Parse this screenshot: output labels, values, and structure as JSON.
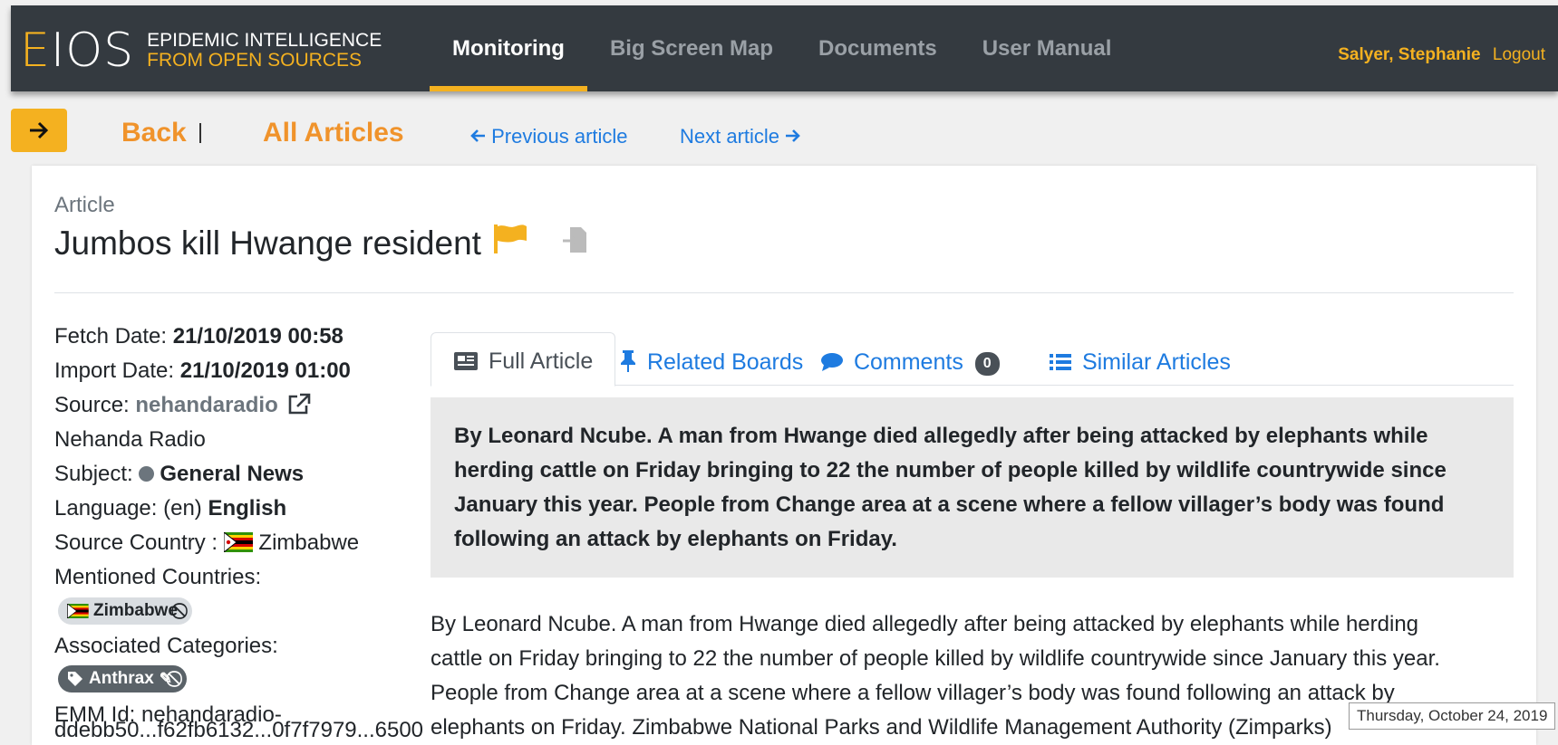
{
  "header": {
    "logo_mark": "EIOS",
    "logo_line1": "EPIDEMIC INTELLIGENCE",
    "logo_line2": "FROM OPEN SOURCES",
    "nav": [
      "Monitoring",
      "Big Screen Map",
      "Documents",
      "User Manual"
    ],
    "active_nav": "Monitoring",
    "user_name": "Salyer, Stephanie",
    "logout": "Logout"
  },
  "subnav": {
    "back": "Back",
    "all_articles": "All Articles",
    "previous": "Previous article",
    "next": "Next article"
  },
  "article": {
    "kicker": "Article",
    "title": "Jumbos kill Hwange resident",
    "fetch_label": "Fetch Date: ",
    "fetch_value": "21/10/2019 00:58",
    "import_label": "Import Date: ",
    "import_value": "21/10/2019 01:00",
    "source_label": "Source: ",
    "source_value": "nehandaradio",
    "source_name": "Nehanda Radio",
    "subject_label": "Subject: ",
    "subject_value": "General News",
    "language_label": "Language: (en) ",
    "language_value": "English",
    "source_country_label": "Source Country : ",
    "source_country_value": "Zimbabwe",
    "mentioned_label": "Mentioned Countries:",
    "mentioned_value": "Zimbabwe",
    "categories_label": "Associated Categories:",
    "category_value": "Anthrax",
    "emm_label": "EMM Id: nehandaradio-",
    "emm_cut": "ddebb50...f62fb6132...0f7f7979...6500"
  },
  "tabs": {
    "full_article": "Full Article",
    "related_boards": "Related Boards",
    "comments": "Comments",
    "comments_count": "0",
    "similar_articles": "Similar Articles"
  },
  "content": {
    "summary": "By Leonard Ncube. A man from Hwange died allegedly after being attacked by elephants while herding cattle on Friday bringing to 22 the number of people killed by wildlife countrywide since January this year. People from Change area at a scene where a fellow villager’s body was found following an attack by elephants on Friday.",
    "body_line1": "By Leonard Ncube. A man from Hwange died allegedly after being attacked by elephants while herding",
    "body_line2": "cattle on Friday bringing to 22 the number of people killed by wildlife countrywide since January this year.",
    "body_line3": "People from Change area at a scene where a fellow villager’s body was found following an attack by",
    "body_line4": "elephants on Friday. Zimbabwe National Parks and Wildlife Management Authority (Zimparks)"
  },
  "tooltip": "Thursday, October 24, 2019",
  "colors": {
    "header_bg": "#343a40",
    "accent": "#f4b120",
    "link": "#1e7be0",
    "back_orange": "#f0932b"
  },
  "icons": [
    "arrow-right-icon",
    "arrow-left-icon",
    "flag-icon",
    "export-icon",
    "external-link-icon",
    "newspaper-icon",
    "pin-icon",
    "comment-icon",
    "list-icon",
    "zimbabwe-flag-icon",
    "tag-icon",
    "pencil-icon",
    "ban-icon"
  ]
}
